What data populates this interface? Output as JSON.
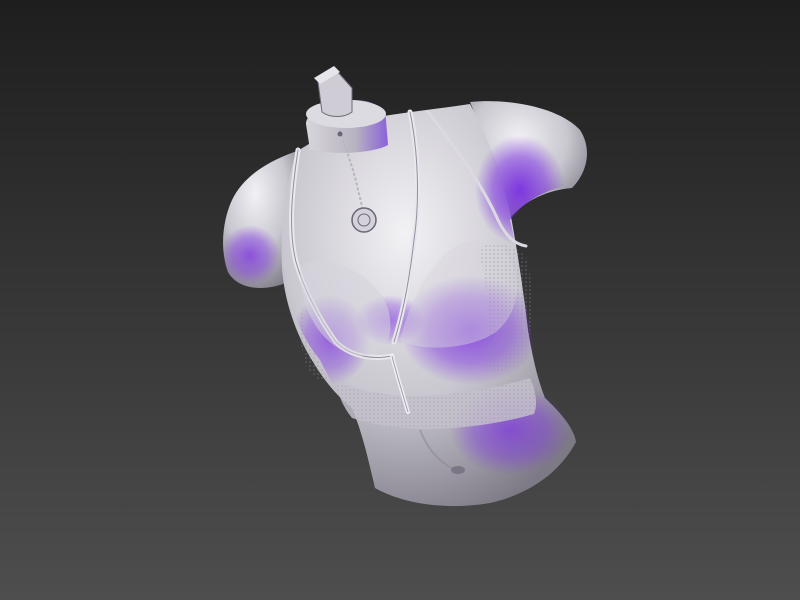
{
  "viewport": {
    "background": {
      "top": "#1e1e1e",
      "bottom": "#4e4e4e"
    },
    "model": {
      "kind": "sculpted-torso-mesh",
      "clay_color": "#c9c7cf",
      "highlight_color": "#f2f1f4",
      "shadow_color": "#7d7a86",
      "accent_color": "#7a2fe0"
    }
  }
}
